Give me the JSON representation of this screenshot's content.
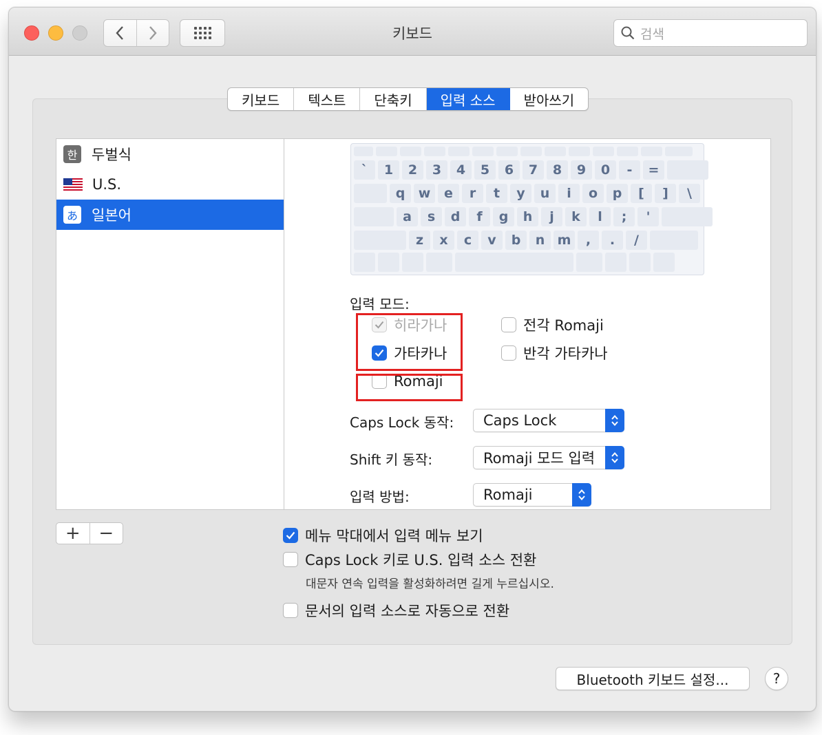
{
  "window": {
    "title": "키보드",
    "search_placeholder": "검색"
  },
  "tabs": [
    {
      "label": "키보드",
      "active": false
    },
    {
      "label": "텍스트",
      "active": false
    },
    {
      "label": "단축키",
      "active": false
    },
    {
      "label": "입력 소스",
      "active": true
    },
    {
      "label": "받아쓰기",
      "active": false
    }
  ],
  "sources": [
    {
      "icon": "한",
      "label": "두벌식",
      "selected": false
    },
    {
      "icon": "us-flag",
      "label": "U.S.",
      "selected": false
    },
    {
      "icon": "あ",
      "label": "일본어",
      "selected": true
    }
  ],
  "keyboard": {
    "row1": [
      "`",
      "1",
      "2",
      "3",
      "4",
      "5",
      "6",
      "7",
      "8",
      "9",
      "0",
      "-",
      "="
    ],
    "row2": [
      "q",
      "w",
      "e",
      "r",
      "t",
      "y",
      "u",
      "i",
      "o",
      "p",
      "[",
      "]",
      "\\"
    ],
    "row3": [
      "a",
      "s",
      "d",
      "f",
      "g",
      "h",
      "j",
      "k",
      "l",
      ";",
      "'"
    ],
    "row4": [
      "z",
      "x",
      "c",
      "v",
      "b",
      "n",
      "m",
      ",",
      ".",
      "/"
    ]
  },
  "input_mode": {
    "label": "입력 모드:",
    "hiragana": "히라가나",
    "katakana": "가타카나",
    "romaji": "Romaji",
    "fullwidth_romaji": "전각 Romaji",
    "halfwidth_katakana": "반각 가타카나"
  },
  "settings": {
    "caps_lock_label": "Caps Lock 동작:",
    "caps_lock_value": "Caps Lock",
    "shift_label": "Shift 키 동작:",
    "shift_value": "Romaji 모드 입력",
    "method_label": "입력 방법:",
    "method_value": "Romaji"
  },
  "options": {
    "show_menu": "메뉴 막대에서 입력 메뉴 보기",
    "caps_switch": "Caps Lock 키로 U.S. 입력 소스 전환",
    "caps_hint": "대문자 연속 입력을 활성화하려면 길게 누르십시오.",
    "auto_switch": "문서의 입력 소스로 자동으로 전환"
  },
  "buttons": {
    "plus": "+",
    "minus": "−",
    "bluetooth": "Bluetooth 키보드 설정...",
    "help": "?"
  },
  "colors": {
    "accent": "#1c6ae4",
    "highlight": "#e32121"
  }
}
